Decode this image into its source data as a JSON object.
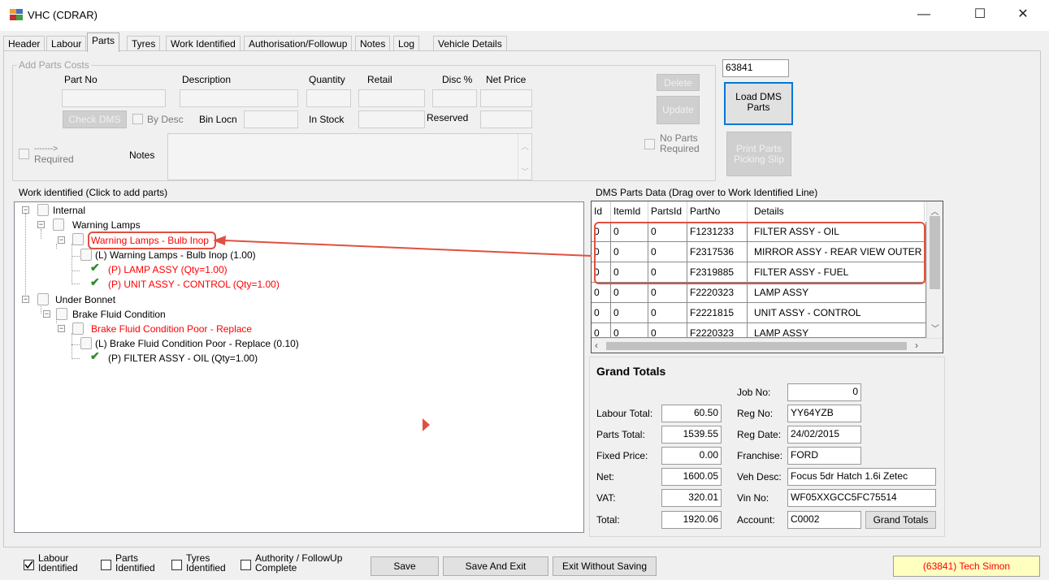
{
  "window": {
    "title": "VHC (CDRAR)",
    "minimize": "—",
    "maximize": "☐",
    "close": "✕"
  },
  "tabs": [
    "Header",
    "Labour",
    "Parts",
    "Tyres",
    "Work Identified",
    "Authorisation/Followup",
    "Notes",
    "Log",
    "Vehicle Details"
  ],
  "active_tab": "Parts",
  "add_parts": {
    "group_label": "Add Parts Costs",
    "part_no_label": "Part No",
    "description_label": "Description",
    "quantity_label": "Quantity",
    "retail_label": "Retail",
    "disc_label": "Disc %",
    "net_price_label": "Net Price",
    "check_dms_button": "Check DMS",
    "by_desc_label": "By Desc",
    "bin_locn_label": "Bin Locn",
    "in_stock_label": "In Stock",
    "reserved_label": "Reserved",
    "required_arrow": "------->",
    "required_label": "Required",
    "notes_label": "Notes",
    "delete_button": "Delete",
    "update_button": "Update",
    "no_parts_label_1": "No Parts",
    "no_parts_label_2": "Required"
  },
  "job_field_value": "63841",
  "load_dms_button_1": "Load DMS",
  "load_dms_button_2": "Parts",
  "print_parts_button_1": "Print Parts",
  "print_parts_button_2": "Picking Slip",
  "work_identified": {
    "label": "Work identified (Click to add parts)",
    "nodes": [
      "Internal",
      "Warning Lamps",
      "Warning Lamps - Bulb Inop",
      "(L) Warning Lamps - Bulb Inop (1.00)",
      "(P) LAMP ASSY (Qty=1.00)",
      "(P) UNIT ASSY - CONTROL (Qty=1.00)",
      "Under Bonnet",
      "Brake Fluid Condition",
      "Brake Fluid Condition Poor -  Replace",
      "(L) Brake Fluid Condition Poor -  Replace (0.10)",
      "(P) FILTER ASSY - OIL (Qty=1.00)"
    ]
  },
  "dms": {
    "label": "DMS Parts Data (Drag over to Work Identified Line)",
    "columns": [
      "Id",
      "ItemId",
      "PartsId",
      "PartNo",
      "Details"
    ],
    "rows": [
      [
        "0",
        "0",
        "0",
        "F1231233",
        "FILTER ASSY - OIL"
      ],
      [
        "0",
        "0",
        "0",
        "F2317536",
        "MIRROR ASSY - REAR VIEW OUTER"
      ],
      [
        "0",
        "0",
        "0",
        "F2319885",
        "FILTER ASSY - FUEL"
      ],
      [
        "0",
        "0",
        "0",
        "F2220323",
        "LAMP ASSY"
      ],
      [
        "0",
        "0",
        "0",
        "F2221815",
        "UNIT ASSY - CONTROL"
      ],
      [
        "0",
        "0",
        "0",
        "F2220323",
        "LAMP ASSY"
      ]
    ]
  },
  "totals": {
    "heading": "Grand Totals",
    "labour_total_label": "Labour Total:",
    "labour_total": "60.50",
    "parts_total_label": "Parts Total:",
    "parts_total": "1539.55",
    "fixed_price_label": "Fixed Price:",
    "fixed_price": "0.00",
    "net_label": "Net:",
    "net": "1600.05",
    "vat_label": "VAT:",
    "vat": "320.01",
    "total_label": "Total:",
    "total": "1920.06",
    "job_no_label": "Job No:",
    "job_no": "0",
    "reg_no_label": "Reg No:",
    "reg_no": "YY64YZB",
    "reg_date_label": "Reg Date:",
    "reg_date": "24/02/2015",
    "franchise_label": "Franchise:",
    "franchise": "FORD",
    "veh_desc_label": "Veh Desc:",
    "veh_desc": "Focus 5dr Hatch 1.6i Zetec",
    "vin_no_label": "Vin No:",
    "vin_no": "WF05XXGCC5FC75514",
    "account_label": "Account:",
    "account": "C0002",
    "grand_totals_button": "Grand Totals"
  },
  "footer": {
    "labour_identified_1": "Labour",
    "labour_identified_2": "Identified",
    "parts_identified_1": "Parts",
    "parts_identified_2": "Identified",
    "tyres_identified_1": "Tyres",
    "tyres_identified_2": "Identified",
    "authority_1": "Authority / FollowUp",
    "authority_2": "Complete",
    "save_button": "Save",
    "save_exit_button": "Save And Exit",
    "exit_without_saving_button": "Exit Without Saving",
    "status": "(63841) Tech Simon"
  },
  "colors": {
    "highlight": "#e05040",
    "tree_red": "#ff0000",
    "tick_green": "#2e8b2e",
    "status_bg": "#ffffc0"
  }
}
